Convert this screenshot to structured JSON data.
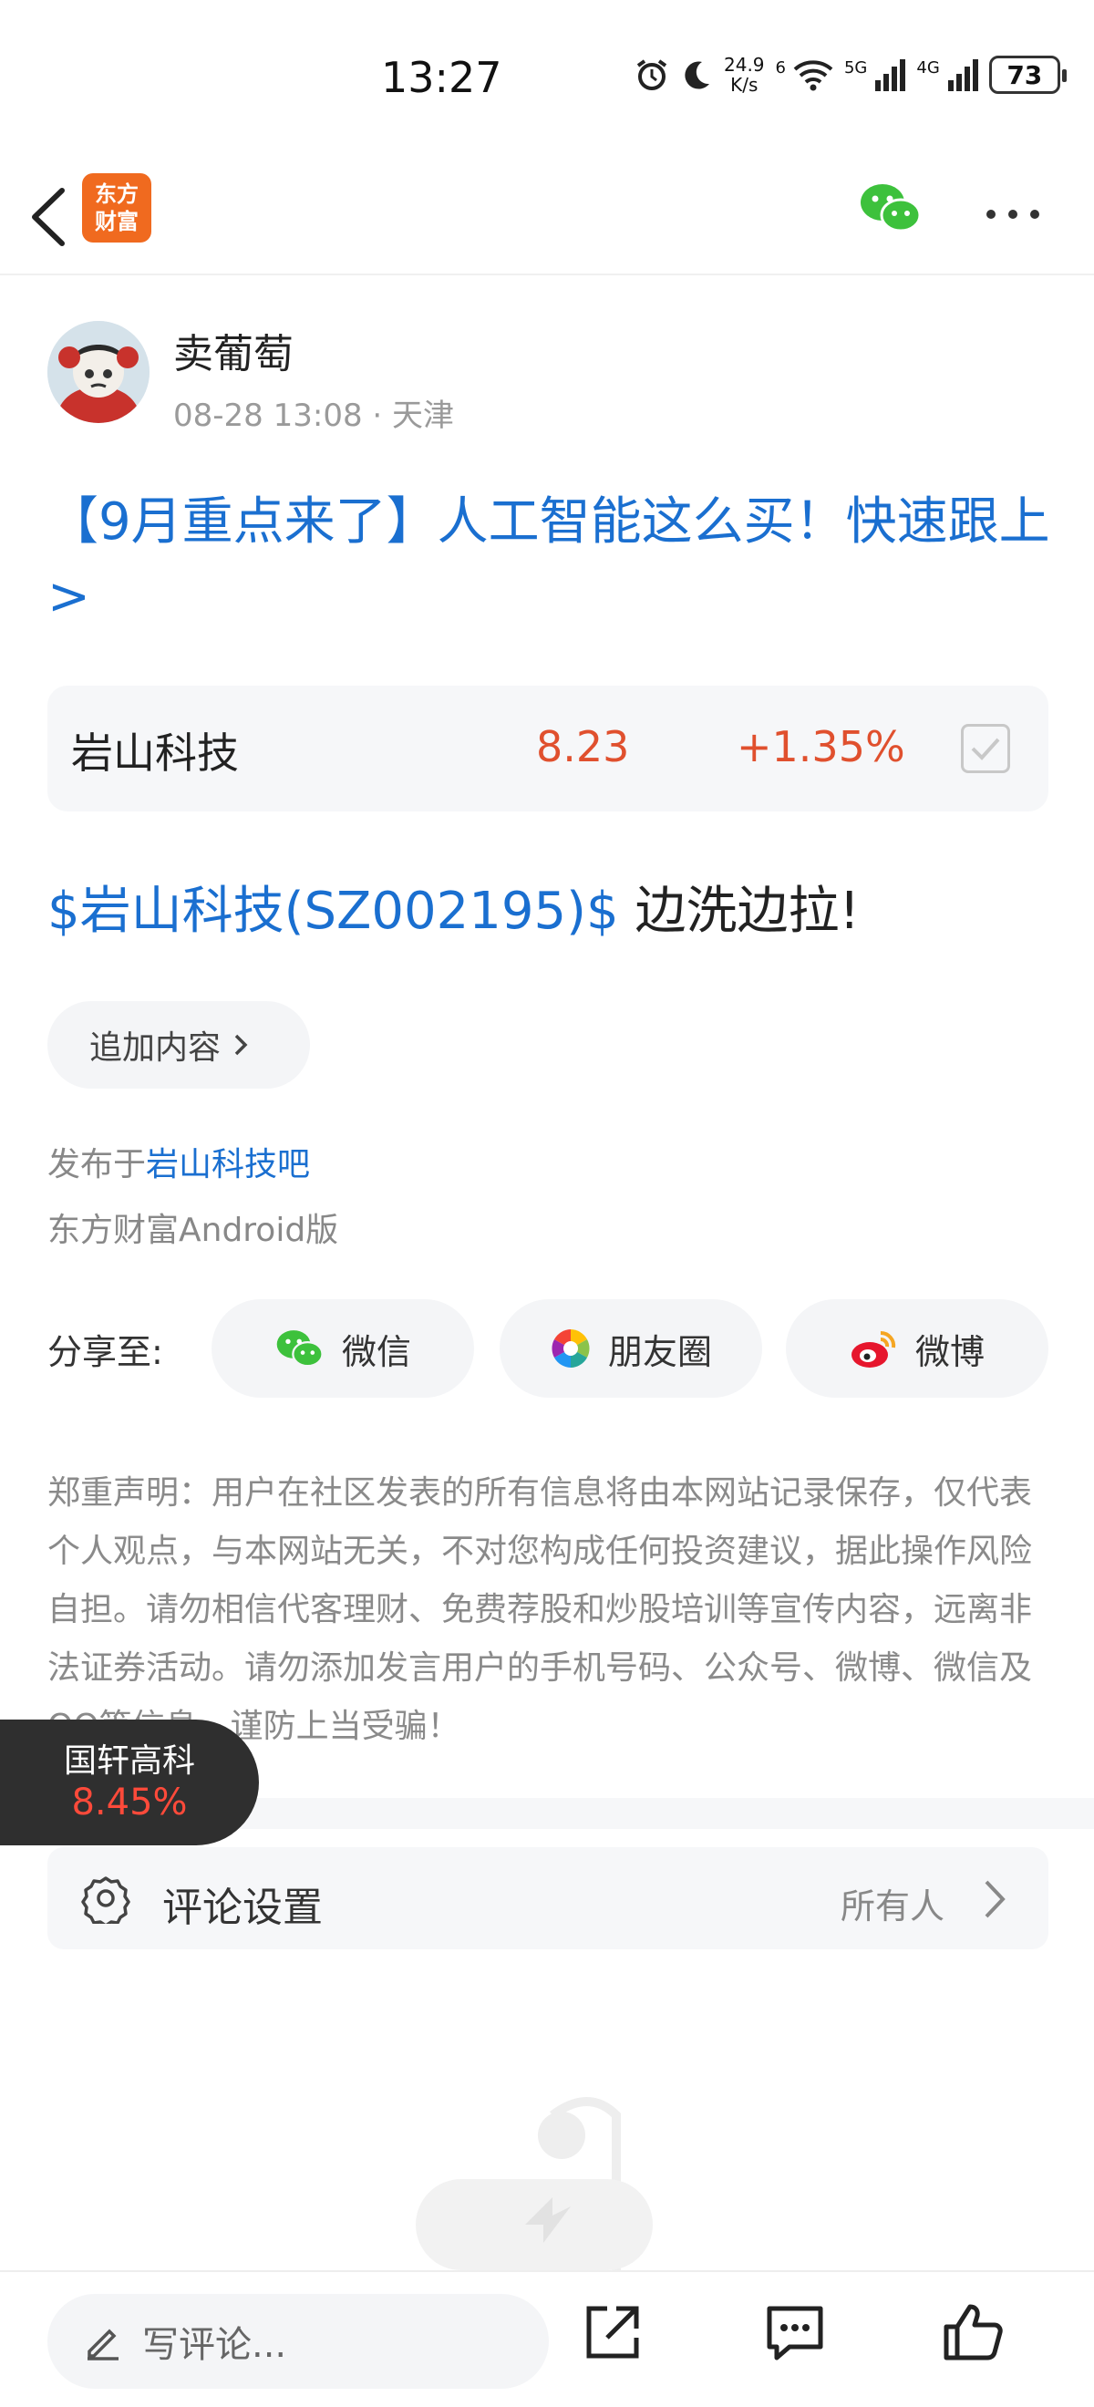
{
  "status_bar": {
    "time": "13:27",
    "net_speed_value": "24.9",
    "net_speed_unit": "K/s",
    "wifi_label": "6",
    "sim1_label": "5G",
    "sim2_label": "4G",
    "battery": "73"
  },
  "nav": {
    "logo_line1": "东方",
    "logo_line2": "财富"
  },
  "author": {
    "name": "卖葡萄",
    "meta": "08-28 13:08 · 天津"
  },
  "post": {
    "title": "【9月重点来了】人工智能这么买！快速跟上>",
    "body_stock_link": "$岩山科技(SZ002195)$",
    "body_text": " 边洗边拉!"
  },
  "stock_card": {
    "name": "岩山科技",
    "price": "8.23",
    "change": "+1.35%",
    "color": "#e0502e"
  },
  "append_button": "追加内容",
  "published": {
    "prefix": "发布于",
    "bar": "岩山科技吧"
  },
  "client": "东方财富Android版",
  "share": {
    "label": "分享至:",
    "wechat": "微信",
    "moments": "朋友圈",
    "weibo": "微博"
  },
  "disclaimer": "郑重声明：用户在社区发表的所有信息将由本网站记录保存，仅代表个人观点，与本网站无关，不对您构成任何投资建议，据此操作风险自担。请勿相信代客理财、免费荐股和炒股培训等宣传内容，远离非法证券活动。请勿添加发言用户的手机号码、公众号、微博、微信及QQ等信息，谨防上当受骗！",
  "comment_settings": {
    "label": "评论设置",
    "value": "所有人"
  },
  "float_tag": {
    "name": "国轩高科",
    "change": "8.45%"
  },
  "bottom_bar": {
    "comment_placeholder": "写评论..."
  },
  "colors": {
    "link": "#1a6fd0",
    "up": "#e0502e",
    "brand": "#f06a1f"
  }
}
